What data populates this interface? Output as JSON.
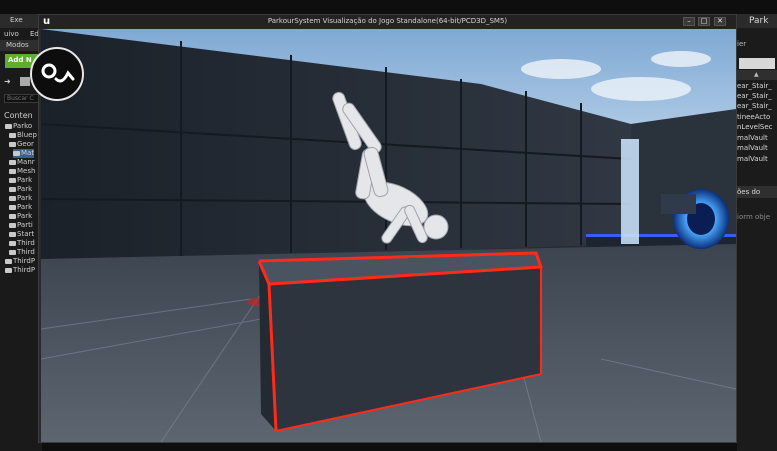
{
  "window": {
    "title": "ParkourSystem Visualização do Jogo Standalone(64-bit/PCD3D_SM5)",
    "minimize": "–",
    "maximize": "□",
    "close": "✕"
  },
  "left_panel": {
    "tab": "Exe",
    "menu_items": [
      "uivo",
      "Ed"
    ],
    "modes": "Modos",
    "add_button": "Add N",
    "search_placeholder": "Buscar C",
    "content_root": "Conten",
    "tree": [
      "Parko",
      "Bluep",
      "Geor",
      "Mat",
      "Manr",
      "Mesh",
      "Park",
      "Park",
      "Park",
      "Park",
      "Park",
      "Parti",
      "Start",
      "Third",
      "Third",
      "ThirdP",
      "ThirdP"
    ]
  },
  "right_panel": {
    "tab": "Park",
    "header": "ier",
    "items": [
      "ear_Stair_",
      "ear_Stair_",
      "ear_Stair_",
      "tineeActo",
      "nLevelSec",
      "malVault",
      "malVault",
      "malVault"
    ],
    "section": "ões do",
    "hint": "iorm obje"
  },
  "icons": {
    "logo": "ue-logo",
    "folder": "folder-icon"
  },
  "colors": {
    "box_edge": "#ff2a1a",
    "portal": "#3aa0ff",
    "sky": "#9ec4e8"
  }
}
